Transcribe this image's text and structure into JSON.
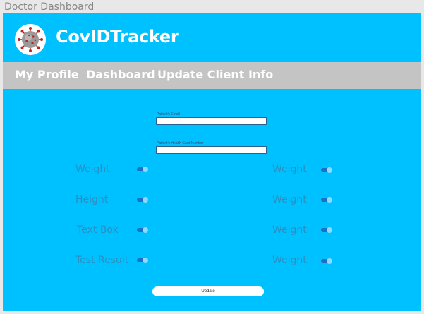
{
  "window": {
    "title": "Doctor Dashboard"
  },
  "header": {
    "app_title": "CovIDTracker",
    "logo_icon": "coronavirus-icon"
  },
  "nav": {
    "items": [
      {
        "label": "My Profile"
      },
      {
        "label": "Dashboard"
      },
      {
        "label": "Update Client Info"
      }
    ]
  },
  "form": {
    "email_label": "Patient's Email",
    "email_value": "",
    "health_card_label": "Patient's Health Card Number",
    "health_card_value": "",
    "left_rows": [
      {
        "label": "Weight",
        "on": true
      },
      {
        "label": "Height",
        "on": true
      },
      {
        "label": "Text Box",
        "on": true
      },
      {
        "label": "Test Result",
        "on": true
      }
    ],
    "right_rows": [
      {
        "label": "Weight",
        "on": true
      },
      {
        "label": "Weight",
        "on": true
      },
      {
        "label": "Weight",
        "on": true
      },
      {
        "label": "Weight",
        "on": true
      }
    ],
    "update_label": "Update"
  },
  "colors": {
    "background": "#00c1ff",
    "nav_bar": "#c4c4c4",
    "row_label": "#2a8fc0",
    "toggle_track": "#1e6fc4",
    "toggle_knob": "#8fd8ff"
  }
}
